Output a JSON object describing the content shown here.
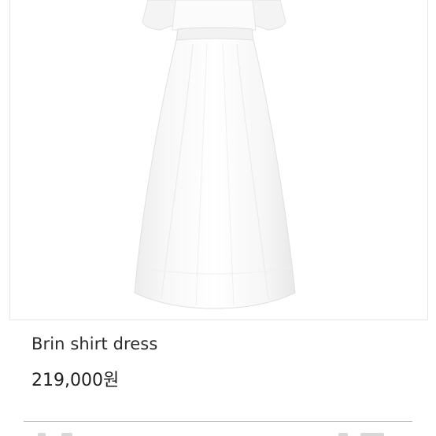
{
  "product": {
    "name": "Brin shirt dress",
    "price": "219,000원",
    "image_icon": "dress-photo"
  },
  "colors": {
    "text": "#2b2b2b",
    "divider": "#bdbdbd",
    "frame_border": "#e6e6e6",
    "dress": "#ffffff"
  }
}
